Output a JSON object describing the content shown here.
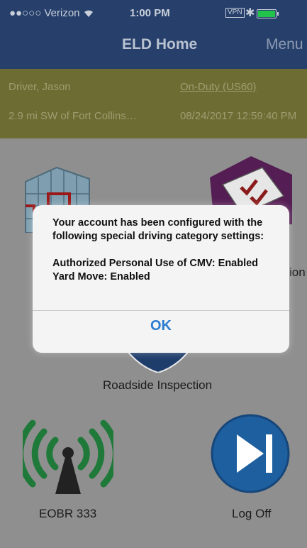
{
  "status_bar": {
    "carrier": "●●○○○ Verizon",
    "wifi_icon": "wifi-icon",
    "time": "1:00 PM",
    "vpn": "VPN",
    "bluetooth": "✱"
  },
  "nav": {
    "title": "ELD Home",
    "menu": "Menu"
  },
  "info": {
    "driver": "Driver, Jason",
    "duty_status": "On-Duty (US60)",
    "location": "2.9 mi SW of Fort Collins…",
    "datetime": "08/24/2017 12:59:40 PM"
  },
  "tiles": {
    "hos": {
      "label": ""
    },
    "inspection_report": {
      "label": "ion"
    },
    "roadside": {
      "label": "Roadside Inspection"
    },
    "eobr": {
      "label": "EOBR 333"
    },
    "logoff": {
      "label": "Log Off"
    }
  },
  "alert": {
    "line1": "Your account has been configured with the following special driving category settings:",
    "line2": "Authorized Personal Use of CMV: Enabled",
    "line3": "Yard Move: Enabled",
    "ok_label": "OK"
  },
  "colors": {
    "nav": "#27406b",
    "info_bar": "#6c6c33",
    "background": "#8f8f8f",
    "accent": "#2a7dd0"
  }
}
